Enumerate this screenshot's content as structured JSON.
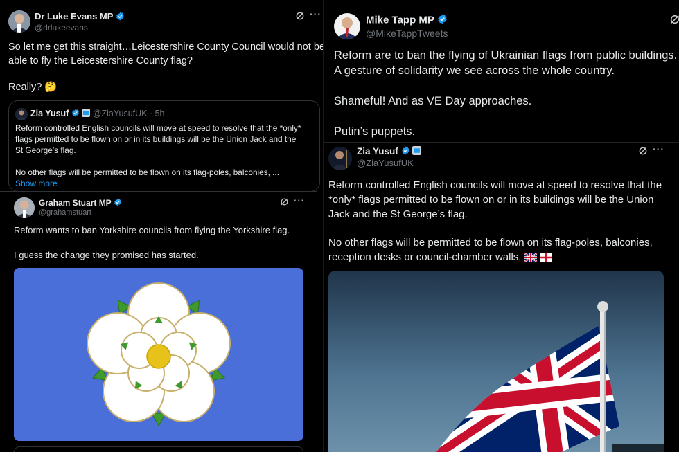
{
  "tweet_evans": {
    "name": "Dr Luke Evans MP",
    "handle": "@drlukeevans",
    "text_line1": "So let me get this straight…Leicestershire County Council would not be",
    "text_line2": "able to fly the Leicestershire County flag?",
    "text_line3": "Really? 🤔",
    "quote": {
      "name": "Zia Yusuf",
      "handle_time": "@ZiaYusufUK · 5h",
      "line1": "Reform controlled English councils will move at speed to resolve that the *only*",
      "line2": "flags permitted to be flown on or in its buildings will be the Union Jack and the",
      "line3": "St George’s flag.",
      "line4": "No other flags will be permitted to be flown on its flag-poles, balconies, ...",
      "show_more": "Show more"
    }
  },
  "tweet_stuart": {
    "name": "Graham Stuart MP",
    "handle": "@grahamstuart",
    "text_line1": "Reform wants to ban Yorkshire councils from flying the Yorkshire flag.",
    "text_line2": "I guess the change they promised has started.",
    "image_alt": "Yorkshire rose flag"
  },
  "tweet_tapp": {
    "name": "Mike Tapp MP",
    "handle": "@MikeTappTweets",
    "text_line1": "Reform are to ban the flying of Ukrainian flags from public buildings.",
    "text_line2": "A gesture of solidarity we see across the whole country.",
    "text_line3": "Shameful! And as VE Day approaches.",
    "text_line4": "Putin’s puppets."
  },
  "tweet_yusuf": {
    "name": "Zia Yusuf",
    "handle": "@ZiaYusufUK",
    "text_line1": "Reform controlled English councils will move at speed to resolve that the",
    "text_line2": "*only* flags permitted to be flown on or in its buildings will be the Union",
    "text_line3": "Jack and the St George’s flag.",
    "text_line4": "No other flags will be permitted to be flown on its flag-poles, balconies,",
    "text_line5": "reception desks or council-chamber walls.",
    "image_alt": "Union Jack flag on flagpole"
  },
  "colors": {
    "verified": "#1d9bf0",
    "background": "#000000",
    "text": "#e7e9ea",
    "muted": "#71767b",
    "yorkshire_blue": "#4a6fd8"
  },
  "icons": [
    "verified-badge-icon",
    "grok-icon",
    "more-dots-icon",
    "thinking-face-emoji",
    "uk-flag-emoji",
    "england-flag-emoji"
  ]
}
